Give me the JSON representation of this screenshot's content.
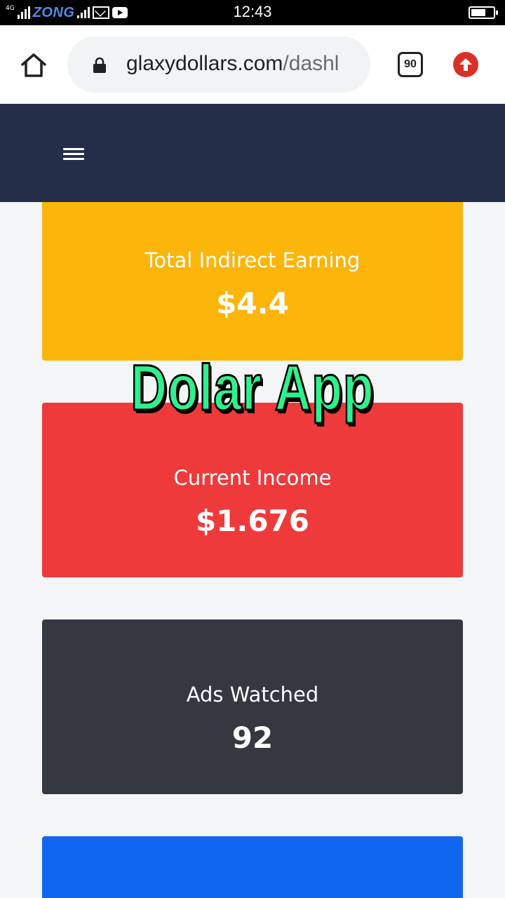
{
  "status_bar": {
    "network": "4G",
    "carrier": "ZONG",
    "time": "12:43",
    "icons": [
      "signal-icon",
      "mail-icon",
      "youtube-icon",
      "battery-icon"
    ]
  },
  "browser": {
    "url_domain": "glaxydollars.com",
    "url_path": "/dashl",
    "tab_count": "90",
    "icons": [
      "home-icon",
      "lock-icon",
      "upload-icon"
    ]
  },
  "navbar": {
    "menu_icon": "hamburger-icon",
    "background": "#252e48"
  },
  "cards": [
    {
      "label": "Total Indirect Earning",
      "value": "$4.4",
      "color": "#fbb50b"
    },
    {
      "label": "Current Income",
      "value": "$1.676",
      "color": "#ef3a3b"
    },
    {
      "label": "Ads Watched",
      "value": "92",
      "color": "#343841"
    },
    {
      "label": "",
      "value": "",
      "color": "#1166f1"
    }
  ],
  "overlay_text": "Dolar App",
  "colors": {
    "overlay_text": "#2ef18e",
    "up_button": "#d93025"
  }
}
